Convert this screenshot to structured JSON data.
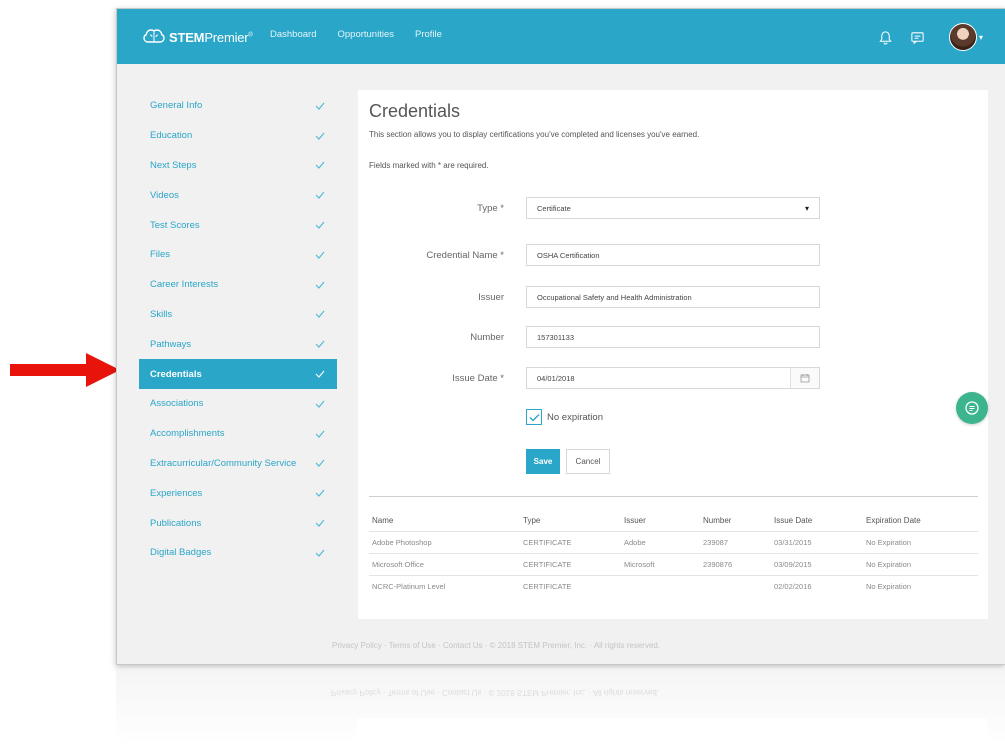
{
  "brand": {
    "name_bold": "STEM",
    "name_rest": "Premier",
    "tm": "®"
  },
  "nav": {
    "links": [
      "Dashboard",
      "Opportunities",
      "Profile"
    ]
  },
  "sidebar": {
    "items": [
      {
        "label": "General Info"
      },
      {
        "label": "Education"
      },
      {
        "label": "Next Steps"
      },
      {
        "label": "Videos"
      },
      {
        "label": "Test Scores"
      },
      {
        "label": "Files"
      },
      {
        "label": "Career Interests"
      },
      {
        "label": "Skills"
      },
      {
        "label": "Pathways"
      },
      {
        "label": "Credentials",
        "active": true
      },
      {
        "label": "Associations"
      },
      {
        "label": "Accomplishments"
      },
      {
        "label": "Extracurricular/Community Service"
      },
      {
        "label": "Experiences"
      },
      {
        "label": "Publications"
      },
      {
        "label": "Digital Badges"
      }
    ]
  },
  "main": {
    "title": "Credentials",
    "description": "This section allows you to display certifications you've completed and licenses you've earned.",
    "required_note": "Fields marked with * are required.",
    "form": {
      "type": {
        "label": "Type *",
        "value": "Certificate"
      },
      "credential_name": {
        "label": "Credential Name *",
        "value": "OSHA Certification"
      },
      "issuer": {
        "label": "Issuer",
        "value": "Occupational Safety and Health Administration"
      },
      "number": {
        "label": "Number",
        "value": "157301133"
      },
      "issue_date": {
        "label": "Issue Date *",
        "value": "04/01/2018"
      },
      "no_expiration": {
        "label": "No expiration",
        "checked": true
      },
      "save_label": "Save",
      "cancel_label": "Cancel"
    },
    "table": {
      "headers": [
        "Name",
        "Type",
        "Issuer",
        "Number",
        "Issue Date",
        "Expiration Date"
      ],
      "rows": [
        [
          "Adobe Photoshop",
          "CERTIFICATE",
          "Adobe",
          "239087",
          "03/31/2015",
          "No Expiration"
        ],
        [
          "Microsoft Office",
          "CERTIFICATE",
          "Microsoft",
          "2390876",
          "03/09/2015",
          "No Expiration"
        ],
        [
          "NCRC-Platinum Level",
          "CERTIFICATE",
          "",
          "",
          "02/02/2016",
          "No Expiration"
        ]
      ]
    }
  },
  "footer": {
    "text": "Privacy Policy  ·  Terms of Use  ·  Contact Us  ·  © 2018 STEM Premier, Inc.  ·  All rights reserved."
  },
  "icons": {
    "logo": "brain-logo-icon",
    "notifications": "bell-icon",
    "messages": "message-icon",
    "check": "check-icon",
    "calendar": "calendar-icon",
    "chat": "chat-icon",
    "arrow": "red-arrow-icon"
  },
  "colors": {
    "primary": "#2aa6c8",
    "chat": "#3cb58f",
    "arrow": "#e8140c"
  }
}
